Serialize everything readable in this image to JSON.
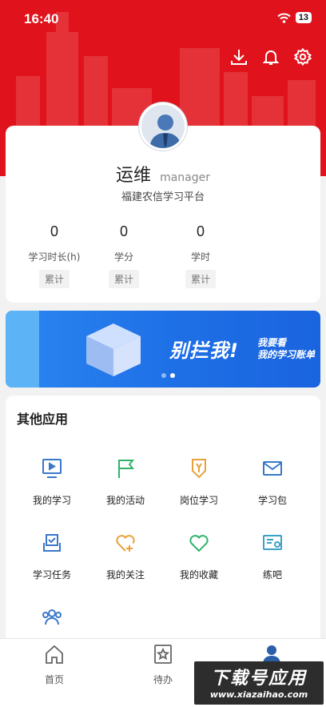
{
  "status_bar": {
    "time": "16:40",
    "battery": "13"
  },
  "profile": {
    "name": "运维",
    "role": "manager",
    "org": "福建农信学习平台",
    "stats": [
      {
        "value": "0",
        "label": "学习时长(h)",
        "tag": "累计"
      },
      {
        "value": "0",
        "label": "学分",
        "tag": "累计"
      },
      {
        "value": "0",
        "label": "学时",
        "tag": "累计"
      }
    ]
  },
  "banner": {
    "main": "别拦我!",
    "sub_line1": "我要看",
    "sub_line2": "我的学习账单"
  },
  "apps": {
    "title": "其他应用",
    "items": [
      {
        "label": "我的学习",
        "icon": "play-screen-icon",
        "color": "#3a78c9"
      },
      {
        "label": "我的活动",
        "icon": "flag-icon",
        "color": "#2fb36b"
      },
      {
        "label": "岗位学习",
        "icon": "badge-icon",
        "color": "#e8a13a"
      },
      {
        "label": "学习包",
        "icon": "envelope-icon",
        "color": "#3a78c9"
      },
      {
        "label": "学习任务",
        "icon": "task-check-icon",
        "color": "#3a78c9"
      },
      {
        "label": "我的关注",
        "icon": "heart-plus-icon",
        "color": "#e8a13a"
      },
      {
        "label": "我的收藏",
        "icon": "heart-icon",
        "color": "#2fb36b"
      },
      {
        "label": "练吧",
        "icon": "practice-icon",
        "color": "#3aa0c9"
      },
      {
        "label": "",
        "icon": "group-icon",
        "color": "#3a78c9"
      }
    ]
  },
  "tabbar": {
    "items": [
      {
        "label": "首页",
        "icon": "home-icon"
      },
      {
        "label": "待办",
        "icon": "todo-star-icon"
      },
      {
        "label": "",
        "icon": "profile-icon"
      }
    ]
  },
  "watermark": {
    "big": "下载号应用",
    "small": "www.xiazaihao.com"
  },
  "colors": {
    "brand_red": "#e0131c",
    "banner_blue": "#1e6fe6"
  }
}
